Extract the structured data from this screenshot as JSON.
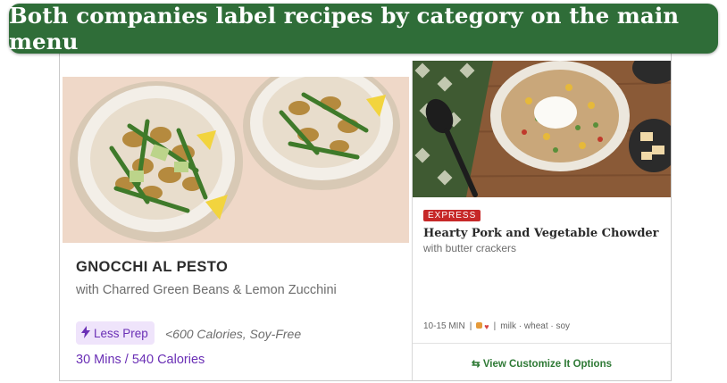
{
  "banner": {
    "text": "Both companies label recipes by category on the main menu"
  },
  "left_card": {
    "title": "GNOCCHI AL PESTO",
    "subtitle": "with Charred Green Beans & Lemon Zucchini",
    "badge_label": "Less Prep",
    "badge_icon": "lightning-icon",
    "calorie_note": "<600 Calories, Soy-Free",
    "time_calories": "30 Mins / 540 Calories"
  },
  "right_card": {
    "tag": "EXPRESS",
    "title": "Hearty Pork and Vegetable Chowder",
    "subtitle": "with butter crackers",
    "time": "10-15 MIN",
    "separator": "|",
    "allergens": "milk · wheat · soy",
    "customize_label": "View Customize It Options",
    "customize_icon": "swap-arrows-icon"
  },
  "colors": {
    "banner": "#2f6d38",
    "accent_purple": "#6a2fb5",
    "express_red": "#c62828",
    "link_green": "#2f7a36"
  }
}
